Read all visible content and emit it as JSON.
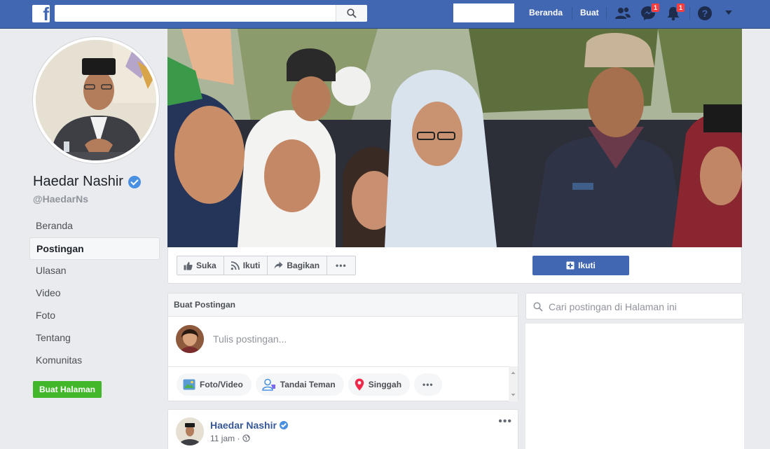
{
  "topbar": {
    "logo": "f",
    "search": {
      "value": "",
      "placeholder": ""
    },
    "nav_home": "Beranda",
    "nav_create": "Buat",
    "messenger_badge": "1",
    "notif_badge": "1",
    "icons": [
      "search-icon",
      "friends-icon",
      "messenger-icon",
      "notifications-icon",
      "help-icon",
      "caret-down-icon"
    ]
  },
  "profile": {
    "name": "Haedar Nashir",
    "handle": "@HaedarNs",
    "verified": true
  },
  "sidebar": {
    "items": [
      {
        "label": "Beranda"
      },
      {
        "label": "Postingan",
        "active": true
      },
      {
        "label": "Ulasan"
      },
      {
        "label": "Video"
      },
      {
        "label": "Foto"
      },
      {
        "label": "Tentang"
      },
      {
        "label": "Komunitas"
      }
    ],
    "create_page": "Buat Halaman"
  },
  "actions": {
    "like": "Suka",
    "follow_feed": "Ikuti",
    "share": "Bagikan",
    "more": "•••",
    "follow_primary": "Ikuti"
  },
  "composer": {
    "title": "Buat Postingan",
    "placeholder": "Tulis postingan...",
    "tools": [
      {
        "label": "Foto/Video",
        "icon": "photo-icon"
      },
      {
        "label": "Tandai Teman",
        "icon": "tag-friend-icon"
      },
      {
        "label": "Singgah",
        "icon": "location-pin-icon"
      }
    ],
    "more": "•••"
  },
  "post": {
    "author": "Haedar Nashir",
    "time": "11 jam",
    "privacy_icon": "globe-icon",
    "more": "•••"
  },
  "page_search": {
    "placeholder": "Cari postingan di Halaman ini",
    "value": ""
  },
  "colors": {
    "brand": "#4267b2",
    "green": "#42b72a",
    "badge": "#fa3e3e"
  }
}
